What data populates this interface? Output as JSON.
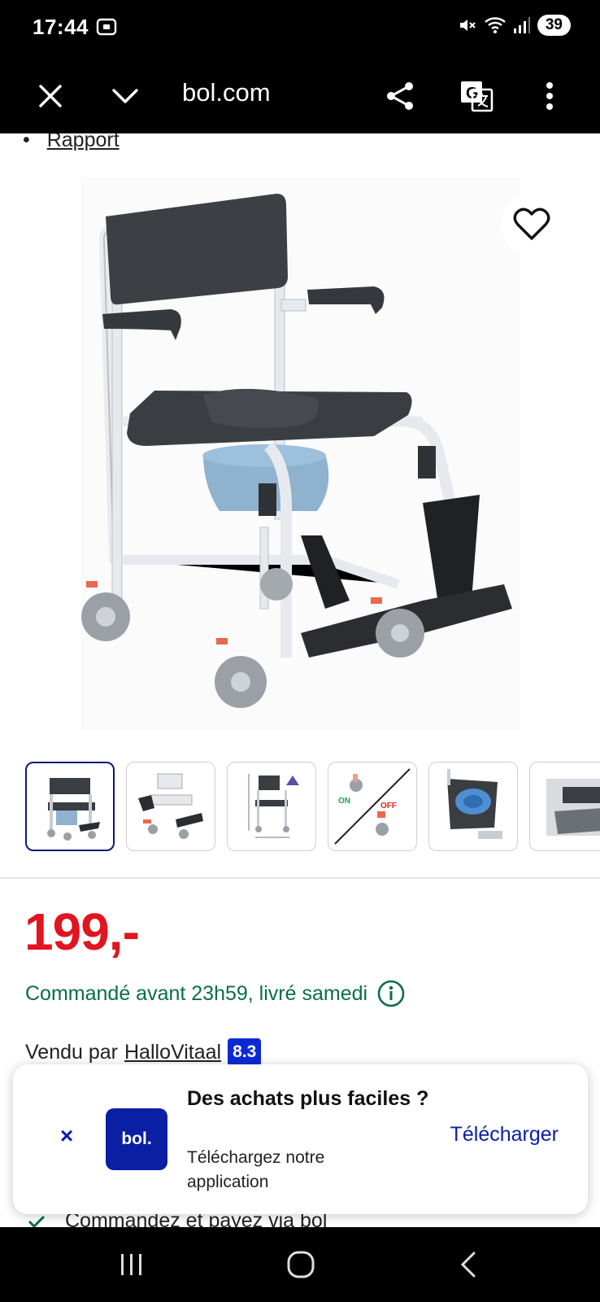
{
  "status": {
    "time": "17:44",
    "battery": "39"
  },
  "browser": {
    "title": "bol.com",
    "icons": [
      "close-icon",
      "chevron-down-icon",
      "share-icon",
      "translate-icon",
      "more-vert-icon"
    ]
  },
  "page": {
    "rapport_link": "Rapport",
    "thumbnails": [
      "commode-chair-front",
      "commode-chair-angle",
      "commode-chair-dimensions",
      "brake-on-off",
      "commode-bucket",
      "commode-chair-detail"
    ],
    "thumb_labels": {
      "on": "ON",
      "off": "OFF"
    },
    "price": "199,-",
    "delivery": "Commandé avant 23h59, livré samedi",
    "seller_prefix": "Vendu par",
    "seller_name": "HalloVitaal",
    "seller_score": "8.3",
    "partial_row_text": "Commandez et payez via bol"
  },
  "app_banner": {
    "logo_text": "bol.",
    "title": "Des achats plus faciles ?",
    "subtitle": "Téléchargez notre application",
    "cta": "Télécharger",
    "close_label": "×"
  },
  "colors": {
    "price": "#e2141f",
    "delivery": "#0a6e48",
    "brand": "#0a1fa3",
    "seller_score_bg": "#0b2ad6"
  }
}
